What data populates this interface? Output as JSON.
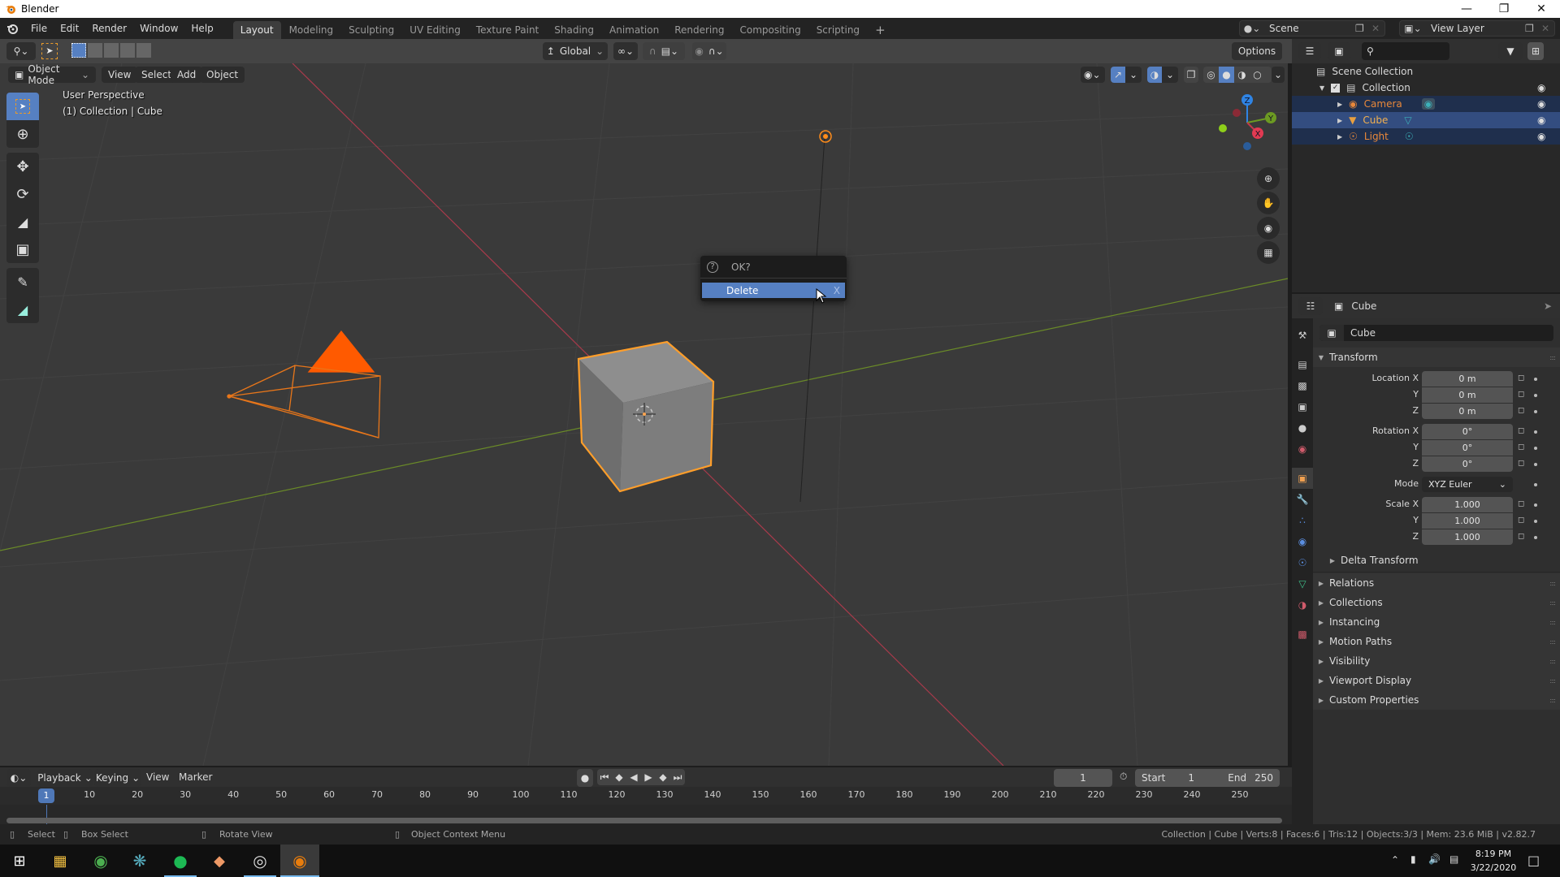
{
  "window": {
    "title": "Blender",
    "minimize_icon": "minimize-icon",
    "maximize_icon": "restore-icon",
    "close_icon": "close-icon"
  },
  "topbar": {
    "menus": [
      "File",
      "Edit",
      "Render",
      "Window",
      "Help"
    ],
    "workspaces": [
      "Layout",
      "Modeling",
      "Sculpting",
      "UV Editing",
      "Texture Paint",
      "Shading",
      "Animation",
      "Rendering",
      "Compositing",
      "Scripting"
    ],
    "active_workspace": "Layout",
    "add_workspace": "+",
    "scene_name": "Scene",
    "view_layer": "View Layer"
  },
  "tool_header": {
    "orientation": "Global",
    "options_label": "Options"
  },
  "viewport_header": {
    "mode": "Object Mode",
    "menus": [
      "View",
      "Select",
      "Add",
      "Object"
    ]
  },
  "viewport": {
    "view_name": "User Perspective",
    "context": "(1) Collection | Cube",
    "gizmo_axes": [
      "X",
      "Y",
      "Z"
    ],
    "colors": {
      "selection": "#ff8c1a",
      "x_axis": "#c2384b",
      "y_axis": "#6c9a22",
      "z_axis": "#2f84e4",
      "grid_bg": "#3a3a3a"
    }
  },
  "popup": {
    "title": "OK?",
    "action": "Delete",
    "shortcut": "X"
  },
  "outliner": {
    "root": "Scene Collection",
    "collection": "Collection",
    "objects": [
      {
        "name": "Camera",
        "type": "camera",
        "selected": true,
        "active": false
      },
      {
        "name": "Cube",
        "type": "mesh",
        "selected": true,
        "active": true
      },
      {
        "name": "Light",
        "type": "light",
        "selected": true,
        "active": false
      }
    ]
  },
  "properties": {
    "context_object": "Cube",
    "object_name": "Cube",
    "transform_label": "Transform",
    "location": {
      "label": "Location X",
      "x": "0 m",
      "y": "0 m",
      "z": "0 m"
    },
    "rotation": {
      "label": "Rotation X",
      "x": "0°",
      "y": "0°",
      "z": "0°"
    },
    "mode_label": "Mode",
    "mode_value": "XYZ Euler",
    "scale": {
      "label": "Scale X",
      "x": "1.000",
      "y": "1.000",
      "z": "1.000"
    },
    "axis_y": "Y",
    "axis_z": "Z",
    "delta_transform": "Delta Transform",
    "collapsed_panels": [
      "Relations",
      "Collections",
      "Instancing",
      "Motion Paths",
      "Visibility",
      "Viewport Display",
      "Custom Properties"
    ]
  },
  "timeline": {
    "menus": [
      "Playback",
      "Keying",
      "View",
      "Marker"
    ],
    "current_frame": "1",
    "start_label": "Start",
    "start": "1",
    "end_label": "End",
    "end": "250",
    "ticks": [
      "10",
      "20",
      "30",
      "40",
      "50",
      "60",
      "70",
      "80",
      "90",
      "100",
      "110",
      "120",
      "130",
      "140",
      "150",
      "160",
      "170",
      "180",
      "190",
      "200",
      "210",
      "220",
      "230",
      "240",
      "250"
    ],
    "playhead": "1"
  },
  "statusbar": {
    "hints": [
      "Select",
      "Box Select",
      "Rotate View",
      "Object Context Menu"
    ],
    "stats": "Collection | Cube | Verts:8 | Faces:6 | Tris:12 | Objects:3/3 | Mem: 23.6 MiB | v2.82.7"
  },
  "taskbar": {
    "apps": [
      "windows-start",
      "file-explorer",
      "chrome",
      "davinci-resolve",
      "spotify",
      "gitkraken",
      "obs-studio",
      "blender"
    ],
    "active_app": "blender",
    "time": "8:19 PM",
    "date": "3/22/2020"
  }
}
